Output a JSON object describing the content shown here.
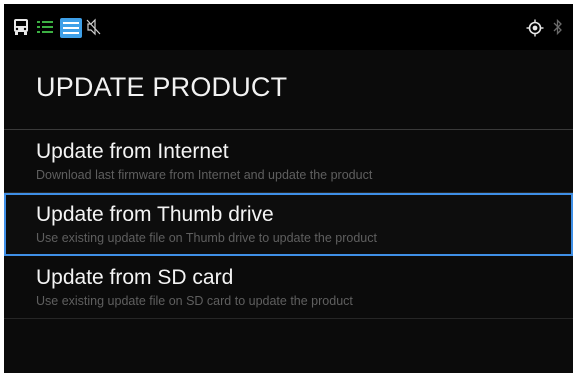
{
  "statusbar": {
    "left_icons": [
      "bus-icon",
      "list-icon",
      "media-icon",
      "muted-speaker-icon"
    ],
    "right_icons": [
      "gps-target-icon",
      "bluetooth-icon"
    ]
  },
  "page": {
    "title": "UPDATE PRODUCT"
  },
  "menu": {
    "items": [
      {
        "title": "Update from Internet",
        "subtitle": "Download last firmware from Internet and update the product",
        "selected": false
      },
      {
        "title": "Update from Thumb drive",
        "subtitle": "Use existing update file on Thumb drive to update the product",
        "selected": true
      },
      {
        "title": "Update from SD card",
        "subtitle": "Use existing update file on SD card to update the product",
        "selected": false
      }
    ]
  },
  "colors": {
    "background": "#0b0b0b",
    "statusbar": "#000000",
    "selection_border": "#3f8fe6",
    "title_text": "#f2f2f2",
    "subtitle_text": "#5f5f5f"
  }
}
